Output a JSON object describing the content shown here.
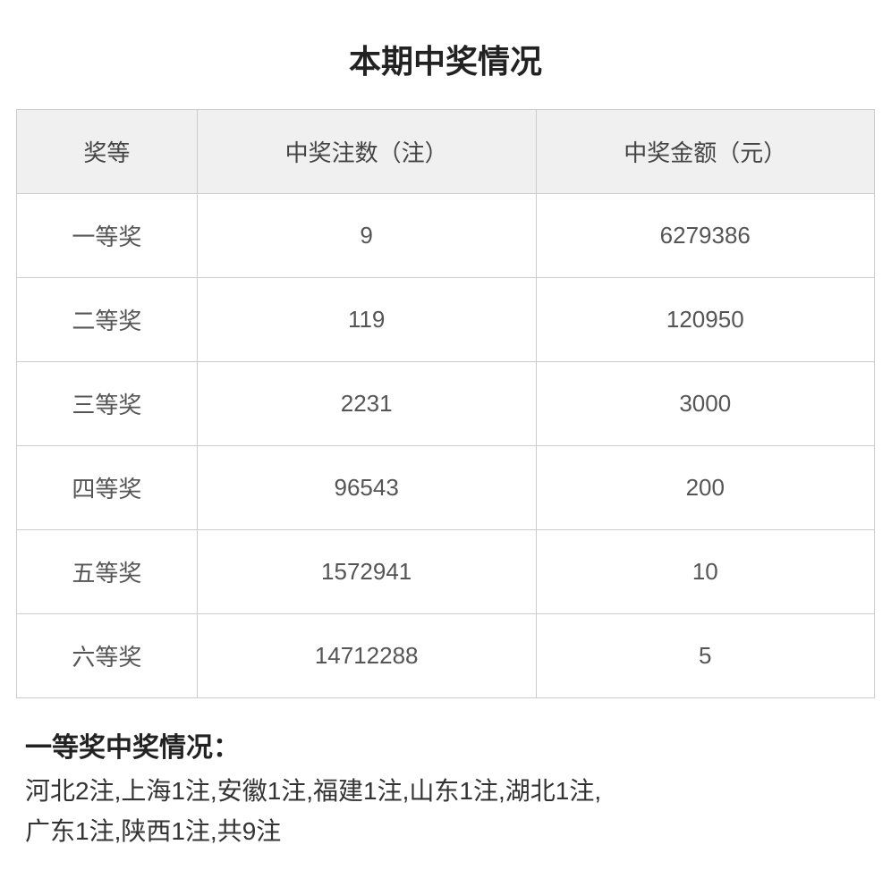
{
  "page": {
    "title": "本期中奖情况"
  },
  "table": {
    "headers": [
      {
        "key": "prize_level",
        "label": "奖等"
      },
      {
        "key": "count",
        "label": "中奖注数（注）"
      },
      {
        "key": "amount",
        "label": "中奖金额（元）"
      }
    ],
    "rows": [
      {
        "level": "一等奖",
        "count": "9",
        "amount": "6279386"
      },
      {
        "level": "二等奖",
        "count": "119",
        "amount": "120950"
      },
      {
        "level": "三等奖",
        "count": "2231",
        "amount": "3000"
      },
      {
        "level": "四等奖",
        "count": "96543",
        "amount": "200"
      },
      {
        "level": "五等奖",
        "count": "1572941",
        "amount": "10"
      },
      {
        "level": "六等奖",
        "count": "14712288",
        "amount": "5"
      }
    ]
  },
  "prize_info": {
    "title": "一等奖中奖情况：",
    "detail_line1": "河北2注,上海1注,安徽1注,福建1注,山东1注,湖北1注,",
    "detail_line2": "广东1注,陕西1注,共9注"
  }
}
